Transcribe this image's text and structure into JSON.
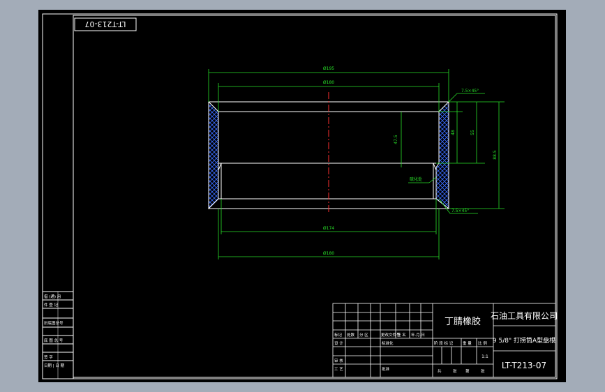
{
  "drawing": {
    "stamp_code": "LT-T213-07",
    "dims": {
      "top_outer": "Ø195",
      "top_inner": "Ø180",
      "bottom_inner": "Ø174",
      "bottom_outer": "Ø180",
      "chamfer_top": "7.5×45°",
      "chamfer_bottom": "7.5×45°",
      "dim_left_vertical": "47.5",
      "dim_mid_a": "48",
      "dim_mid_b": "55",
      "dim_right": "88.5",
      "note_left": "硫化处"
    }
  },
  "left_strip": {
    "rows": [
      "借 (通) 用",
      "件 登 记",
      "",
      "旧底图总号",
      "",
      "底 图 总 号",
      "",
      "签 字",
      "",
      "日期 | 日 期"
    ]
  },
  "title_block": {
    "material": "丁腈橡胶",
    "company": "石油工具有限公司",
    "part_name": "9 5/8\" 打捞筒A型盘根",
    "drawing_code": "LT-T213-07",
    "scale": "1:1",
    "revision_row": [
      "标记",
      "处数",
      "分 区",
      "更改文件号",
      "签 名",
      "年.月.日"
    ],
    "signature_rows": [
      {
        "label": "设 计",
        "mid": "标准化"
      },
      {
        "label": "审 核",
        "mid": ""
      },
      {
        "label": "工 艺",
        "mid": "批准"
      }
    ],
    "stage_row": [
      "阶 段 标 记",
      "重 量",
      "比 例"
    ],
    "sheet_row": [
      "共",
      "张",
      "第",
      "张"
    ]
  }
}
